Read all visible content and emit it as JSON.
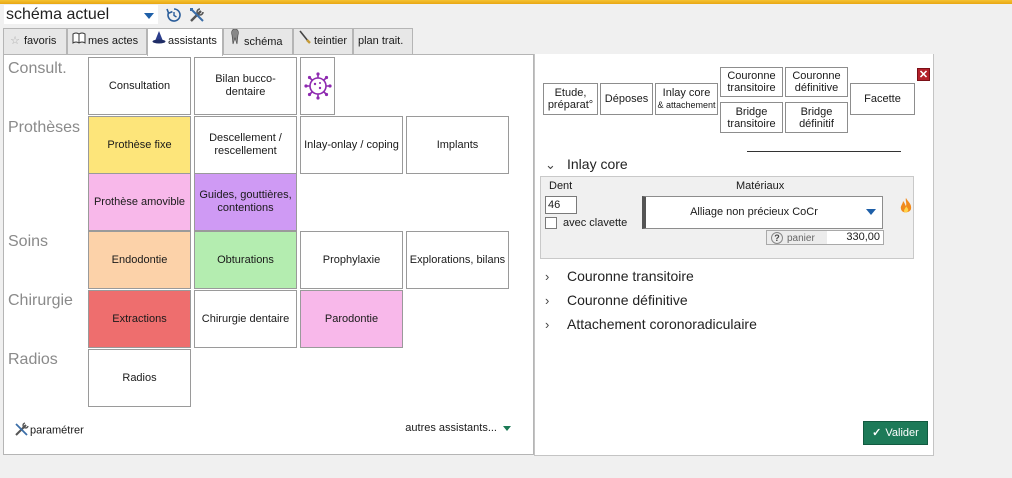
{
  "header": {
    "scheme_value": "schéma actuel",
    "icons": [
      "history-icon",
      "tools-icon"
    ]
  },
  "tabs": [
    {
      "label": "favoris",
      "icon": "star-icon"
    },
    {
      "label": "mes actes",
      "icon": "book-icon"
    },
    {
      "label": "assistants",
      "icon": "wizard-hat-icon"
    },
    {
      "label": "schéma",
      "icon": "tooth-icon"
    },
    {
      "label": "teintier",
      "icon": "brush-icon"
    },
    {
      "label": "plan trait.",
      "icon": ""
    }
  ],
  "left": {
    "categories": [
      "Consult.",
      "Prothèses",
      "Soins",
      "Chirurgie",
      "Radios"
    ],
    "tiles": [
      {
        "label": "Consultation",
        "color": "#ffffff"
      },
      {
        "label": "Bilan bucco-dentaire",
        "color": "#ffffff"
      },
      {
        "label": "Prothèse fixe",
        "color": "#fde57a"
      },
      {
        "label": "Descellement / rescellement",
        "color": "#ffffff"
      },
      {
        "label": "Inlay-onlay / coping",
        "color": "#ffffff"
      },
      {
        "label": "Implants",
        "color": "#ffffff"
      },
      {
        "label": "Prothèse amovible",
        "color": "#f8b8ea"
      },
      {
        "label": "Guides, gouttières, contentions",
        "color": "#cf9af4"
      },
      {
        "label": "Endodontie",
        "color": "#fcd2a9"
      },
      {
        "label": "Obturations",
        "color": "#b4edb0"
      },
      {
        "label": "Prophylaxie",
        "color": "#ffffff"
      },
      {
        "label": "Explorations, bilans",
        "color": "#ffffff"
      },
      {
        "label": "Extractions",
        "color": "#ee6e6e"
      },
      {
        "label": "Chirurgie dentaire",
        "color": "#ffffff"
      },
      {
        "label": "Parodontie",
        "color": "#f8b8ea"
      },
      {
        "label": "Radios",
        "color": "#ffffff"
      }
    ],
    "virus_icon": "virus-icon",
    "param_label": "paramétrer",
    "autres_label": "autres assistants..."
  },
  "right": {
    "buttons": {
      "etude": "Etude, préparat°",
      "deposes": "Déposes",
      "inlay_core": "Inlay core",
      "inlay_core_sub": "& attachement",
      "couronne_transitoire": "Couronne transitoire",
      "couronne_definitive": "Couronne définitive",
      "bridge_transitoire": "Bridge transitoire",
      "bridge_definitif": "Bridge définitif",
      "facette": "Facette"
    },
    "inlay_section": {
      "title": "Inlay core",
      "dent_label": "Dent",
      "dent_value": "46",
      "clavette_label": "avec clavette",
      "clavette_checked": false,
      "materiaux_label": "Matériaux",
      "materiaux_value": "Alliage non précieux CoCr",
      "panier_label": "panier",
      "price": "330,00"
    },
    "collapsed_sections": [
      "Couronne transitoire",
      "Couronne définitive",
      "Attachement coronoradiculaire"
    ],
    "valider_label": "Valider",
    "accent_color": "#1d7a58"
  }
}
